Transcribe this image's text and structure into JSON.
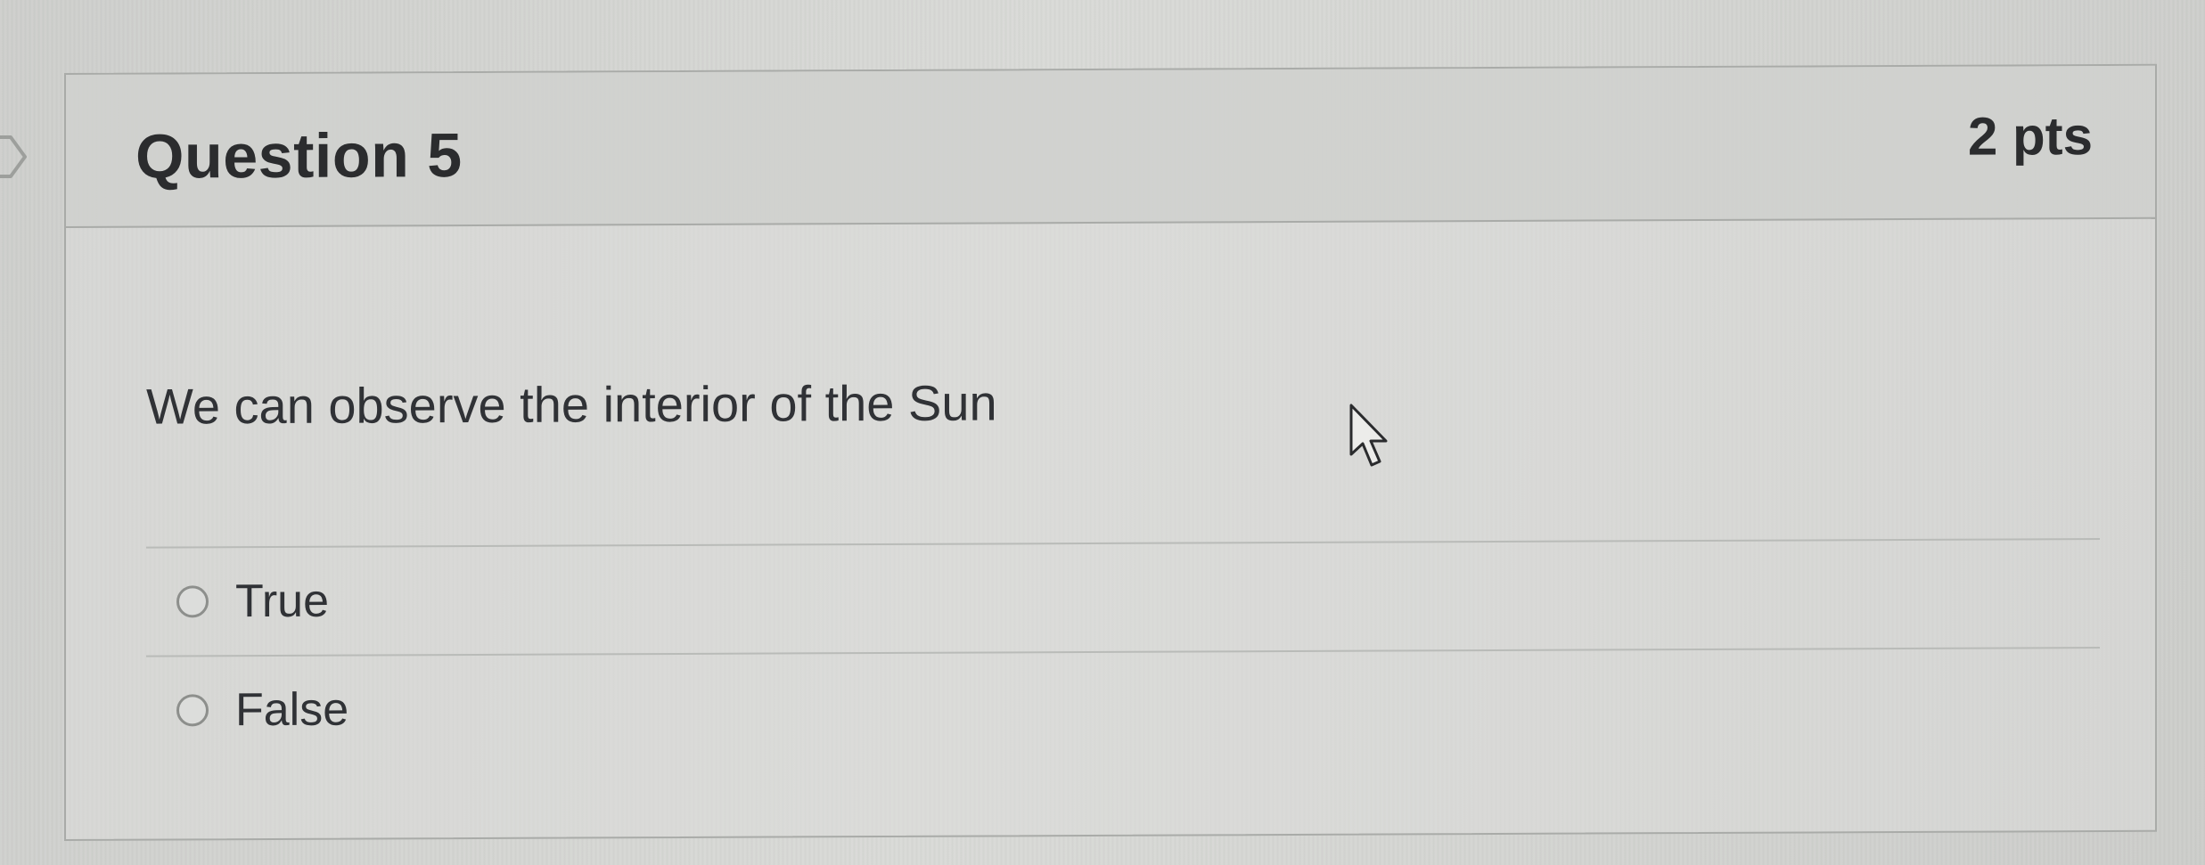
{
  "question": {
    "title": "Question 5",
    "points": "2 pts",
    "prompt": "We can observe the interior of the Sun",
    "answers": [
      {
        "label": "True",
        "selected": false
      },
      {
        "label": "False",
        "selected": false
      }
    ]
  },
  "icons": {
    "flag": "flag-marker-icon",
    "cursor": "mouse-pointer-icon",
    "radio": "radio-button-icon"
  },
  "colors": {
    "text": "#2b2c2e",
    "border": "#a9aba8",
    "radio_border": "#8d8f8c"
  }
}
